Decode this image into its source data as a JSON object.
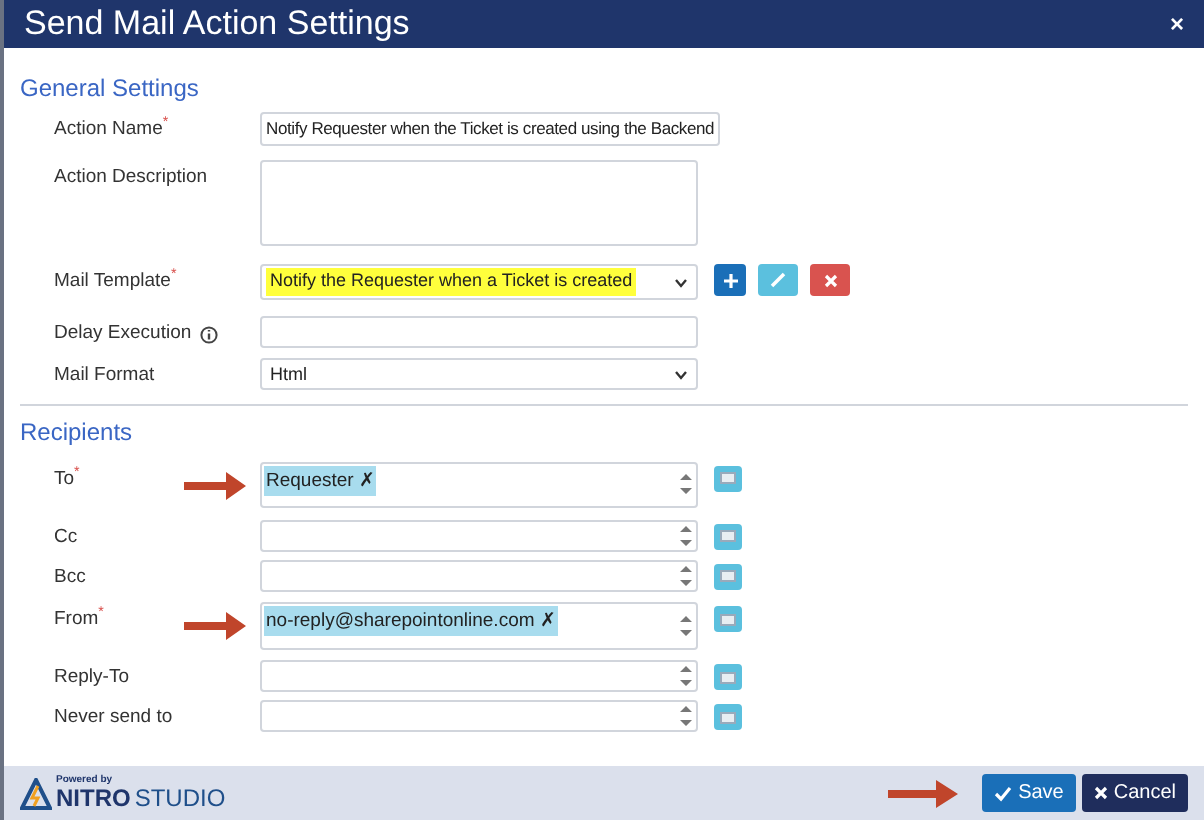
{
  "window": {
    "title": "Send Mail Action Settings",
    "close": "×"
  },
  "general": {
    "title": "General Settings",
    "fields": [
      {
        "kind": "text",
        "label": "Action Name$^{*}$",
        "value": "Notify Requester when the Ticket is created using the Backend"
      },
      {
        "kind": "textarea",
        "label": "Action Description"
      },
      {
        "kind": "select",
        "label": "Mail Template$^{*}$",
        "value": "Notify the Requester when a Ticket is created",
        "highlighted": true,
        "buttons": [
          {
            "kind": "add"
          },
          {
            "kind": "edit"
          },
          {
            "kind": "delete"
          }
        ]
      },
      {
        "kind": "text",
        "label": "Delay Execution",
        "info": true
      },
      {
        "kind": "select",
        "label": "Mail Format",
        "value": "Html",
        "highlighted": false
      }
    ]
  },
  "recipients": {
    "title": "Recipients",
    "fields": [
      {
        "label": "To$^{*}$",
        "tokens": [
          "Requester ✗"
        ],
        "arrow": true
      },
      {
        "label": "Cc",
        "arrow": false
      },
      {
        "label": "Bcc",
        "arrow": false
      },
      {
        "label": "From$^{*}$",
        "tokens": [
          "no-reply@sharepointonline.com ✗"
        ],
        "arrow": true
      },
      {
        "label": "Reply-To",
        "arrow": false
      },
      {
        "label": "Never send to",
        "arrow": false
      }
    ]
  },
  "footer": {
    "brand_small": "Powered by",
    "brand_bold": "NITRO",
    "brand": "STUDIO",
    "save": "Save",
    "cancel": "Cancel",
    "save_arrow": true
  }
}
